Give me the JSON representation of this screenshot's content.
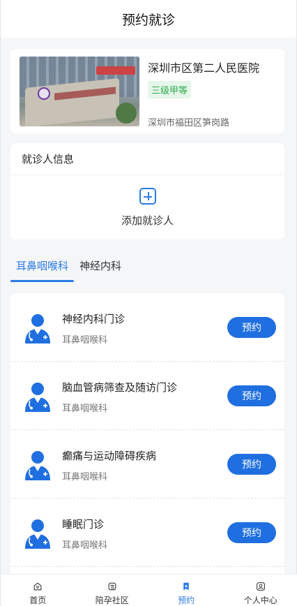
{
  "header": {
    "title": "预约就诊"
  },
  "hospital": {
    "name": "深圳市区第二人民医院",
    "level": "三级甲等",
    "address": "深圳市福田区笋岗路"
  },
  "patient": {
    "title": "就诊人信息",
    "add_label": "添加就诊人"
  },
  "tabs": [
    {
      "label": "耳鼻咽喉科",
      "active": true
    },
    {
      "label": "神经内科",
      "active": false
    }
  ],
  "clinics": [
    {
      "name": "神经内科门诊",
      "dept": "耳鼻咽喉科",
      "button": "预约"
    },
    {
      "name": "脑血管病筛查及随访门诊",
      "dept": "耳鼻咽喉科",
      "button": "预约"
    },
    {
      "name": "癫痛与运动障碍疾病",
      "dept": "耳鼻咽喉科",
      "button": "预约"
    },
    {
      "name": "睡眠门诊",
      "dept": "耳鼻咽喉科",
      "button": "预约"
    }
  ],
  "bottom_nav": [
    {
      "label": "首页",
      "icon": "home-heart-icon",
      "active": false
    },
    {
      "label": "陪孕社区",
      "icon": "community-icon",
      "active": false
    },
    {
      "label": "预约",
      "icon": "bookmark-star-icon",
      "active": true
    },
    {
      "label": "个人中心",
      "icon": "profile-icon",
      "active": false
    }
  ],
  "colors": {
    "accent": "#2b7be4",
    "button": "#1f6fe0",
    "level_green": "#2aa84a"
  }
}
